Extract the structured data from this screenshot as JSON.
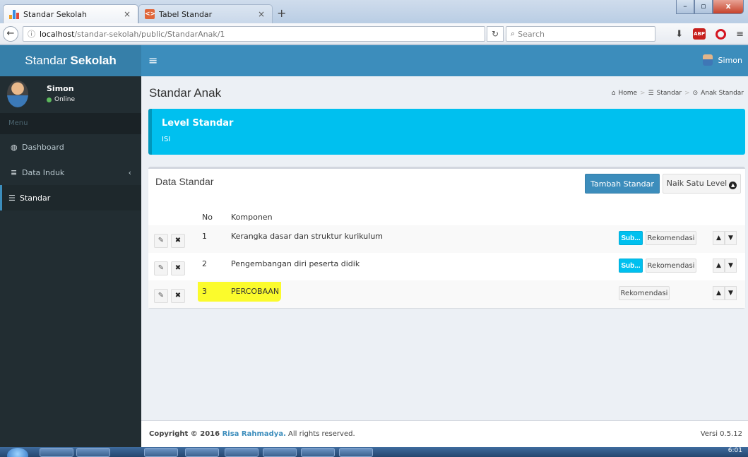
{
  "browser": {
    "tabs": [
      {
        "title": "Standar Sekolah",
        "active": true
      },
      {
        "title": "Tabel Standar",
        "active": false
      }
    ],
    "url_host": "localhost",
    "url_path": "/standar-sekolah/public/StandarAnak/1",
    "search_placeholder": "Search",
    "abp_label": "ABP"
  },
  "app": {
    "logo_light": "Standar ",
    "logo_bold": "Sekolah",
    "header_user": "Simon"
  },
  "sidebar": {
    "user_name": "Simon",
    "user_status": "Online",
    "menu_header": "Menu",
    "items": [
      {
        "label": "Dashboard",
        "icon": "dashboard-icon"
      },
      {
        "label": "Data Induk",
        "icon": "database-icon",
        "has_children": true
      },
      {
        "label": "Standar",
        "icon": "sliders-icon",
        "active": true
      }
    ]
  },
  "content": {
    "page_title": "Standar Anak",
    "breadcrumb": [
      "Home",
      "Standar",
      "Anak Standar"
    ],
    "callout_title": "Level Standar",
    "callout_text": "ISI",
    "box_title": "Data Standar",
    "add_button": "Tambah Standar",
    "up_level_button": "Naik Satu Level",
    "columns": [
      "No",
      "Komponen"
    ],
    "sub_label": "Sub...",
    "rek_label": "Rekomendasi",
    "rows": [
      {
        "no": "1",
        "komponen": "Kerangka dasar dan struktur kurikulum",
        "has_sub": true,
        "highlighted": false
      },
      {
        "no": "2",
        "komponen": "Pengembangan diri peserta didik",
        "has_sub": true,
        "highlighted": false
      },
      {
        "no": "3",
        "komponen": "PERCOBAAN",
        "has_sub": false,
        "highlighted": true
      }
    ]
  },
  "footer": {
    "copyright_prefix": "Copyright © 2016 ",
    "copyright_brand": "Risa Rahmadya.",
    "copyright_suffix": " All rights reserved.",
    "version": "Versi 0.5.12"
  },
  "taskbar": {
    "clock": "6:01"
  },
  "colors": {
    "header_blue": "#3c8dbc",
    "logo_blue": "#367fa9",
    "sidebar_dark": "#222d32",
    "callout_aqua": "#00c0ef",
    "highlight_yellow": "#ffff33"
  }
}
